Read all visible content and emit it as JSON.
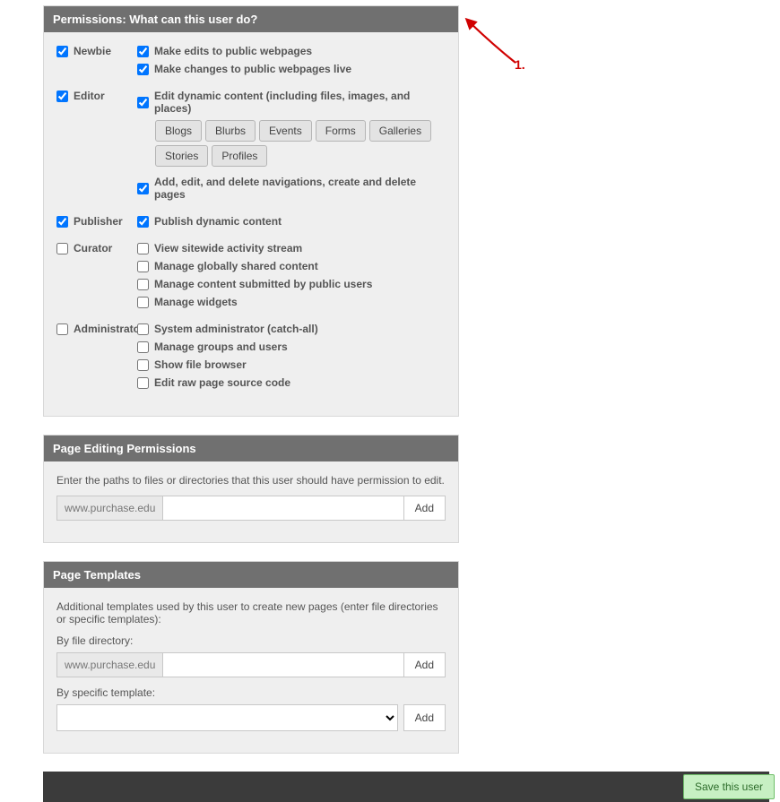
{
  "permissions_panel": {
    "title": "Permissions: What can this user do?",
    "roles": [
      {
        "key": "newbie",
        "label": "Newbie",
        "checked": true,
        "items": [
          {
            "label": "Make edits to public webpages",
            "checked": true
          },
          {
            "label": "Make changes to public webpages live",
            "checked": true
          }
        ]
      },
      {
        "key": "editor",
        "label": "Editor",
        "checked": true,
        "items": [
          {
            "label": "Edit dynamic content (including files, images, and places)",
            "checked": true,
            "tags": [
              "Blogs",
              "Blurbs",
              "Events",
              "Forms",
              "Galleries",
              "Stories",
              "Profiles"
            ]
          },
          {
            "label": "Add, edit, and delete navigations, create and delete pages",
            "checked": true
          }
        ]
      },
      {
        "key": "publisher",
        "label": "Publisher",
        "checked": true,
        "items": [
          {
            "label": "Publish dynamic content",
            "checked": true
          }
        ]
      },
      {
        "key": "curator",
        "label": "Curator",
        "checked": false,
        "items": [
          {
            "label": "View sitewide activity stream",
            "checked": false
          },
          {
            "label": "Manage globally shared content",
            "checked": false
          },
          {
            "label": "Manage content submitted by public users",
            "checked": false
          },
          {
            "label": "Manage widgets",
            "checked": false
          }
        ]
      },
      {
        "key": "administrator",
        "label": "Administrator",
        "checked": false,
        "items": [
          {
            "label": "System administrator (catch-all)",
            "checked": false
          },
          {
            "label": "Manage groups and users",
            "checked": false
          },
          {
            "label": "Show file browser",
            "checked": false
          },
          {
            "label": "Edit raw page source code",
            "checked": false
          }
        ]
      }
    ]
  },
  "page_editing": {
    "title": "Page Editing Permissions",
    "desc": "Enter the paths to files or directories that this user should have permission to edit.",
    "domain": "www.purchase.edu",
    "add_label": "Add"
  },
  "page_templates": {
    "title": "Page Templates",
    "desc": "Additional templates used by this user to create new pages (enter file directories or specific templates):",
    "by_dir_label": "By file directory:",
    "domain": "www.purchase.edu",
    "by_template_label": "By specific template:",
    "add_label": "Add"
  },
  "footer": {
    "save_label": "Save this user"
  },
  "annotation": {
    "label": "1."
  }
}
